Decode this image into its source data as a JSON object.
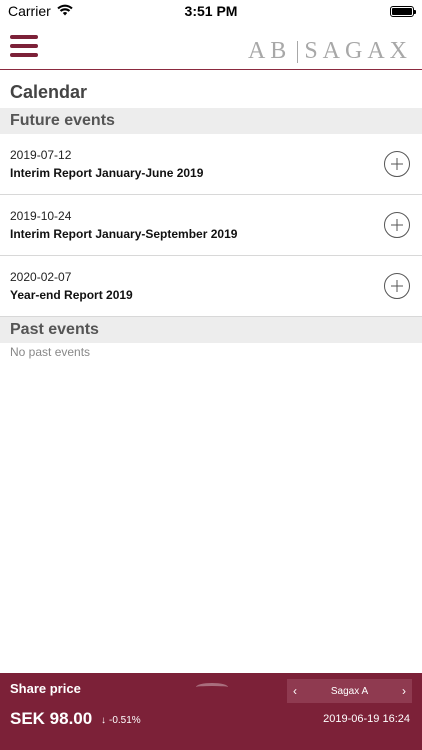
{
  "status_bar": {
    "carrier": "Carrier",
    "time": "3:51 PM",
    "icons": [
      "wifi-icon",
      "battery-icon"
    ]
  },
  "header": {
    "logo_left": "AB",
    "logo_right": "SAGAX",
    "menu_icon": "hamburger-menu-icon",
    "accent_color": "#7c2138"
  },
  "page": {
    "title": "Calendar"
  },
  "future_events": {
    "heading": "Future events",
    "items": [
      {
        "date": "2019-07-12",
        "title": "Interim Report January-June 2019"
      },
      {
        "date": "2019-10-24",
        "title": "Interim Report January-September 2019"
      },
      {
        "date": "2020-02-07",
        "title": "Year-end Report 2019"
      }
    ]
  },
  "past_events": {
    "heading": "Past events",
    "empty_text": "No past events"
  },
  "share": {
    "label": "Share price",
    "selector_value": "Sagax A",
    "price": "SEK 98.00",
    "change_arrow": "↓",
    "change": "-0.51%",
    "datetime": "2019-06-19 16:24",
    "footer_color": "#7c2138"
  }
}
